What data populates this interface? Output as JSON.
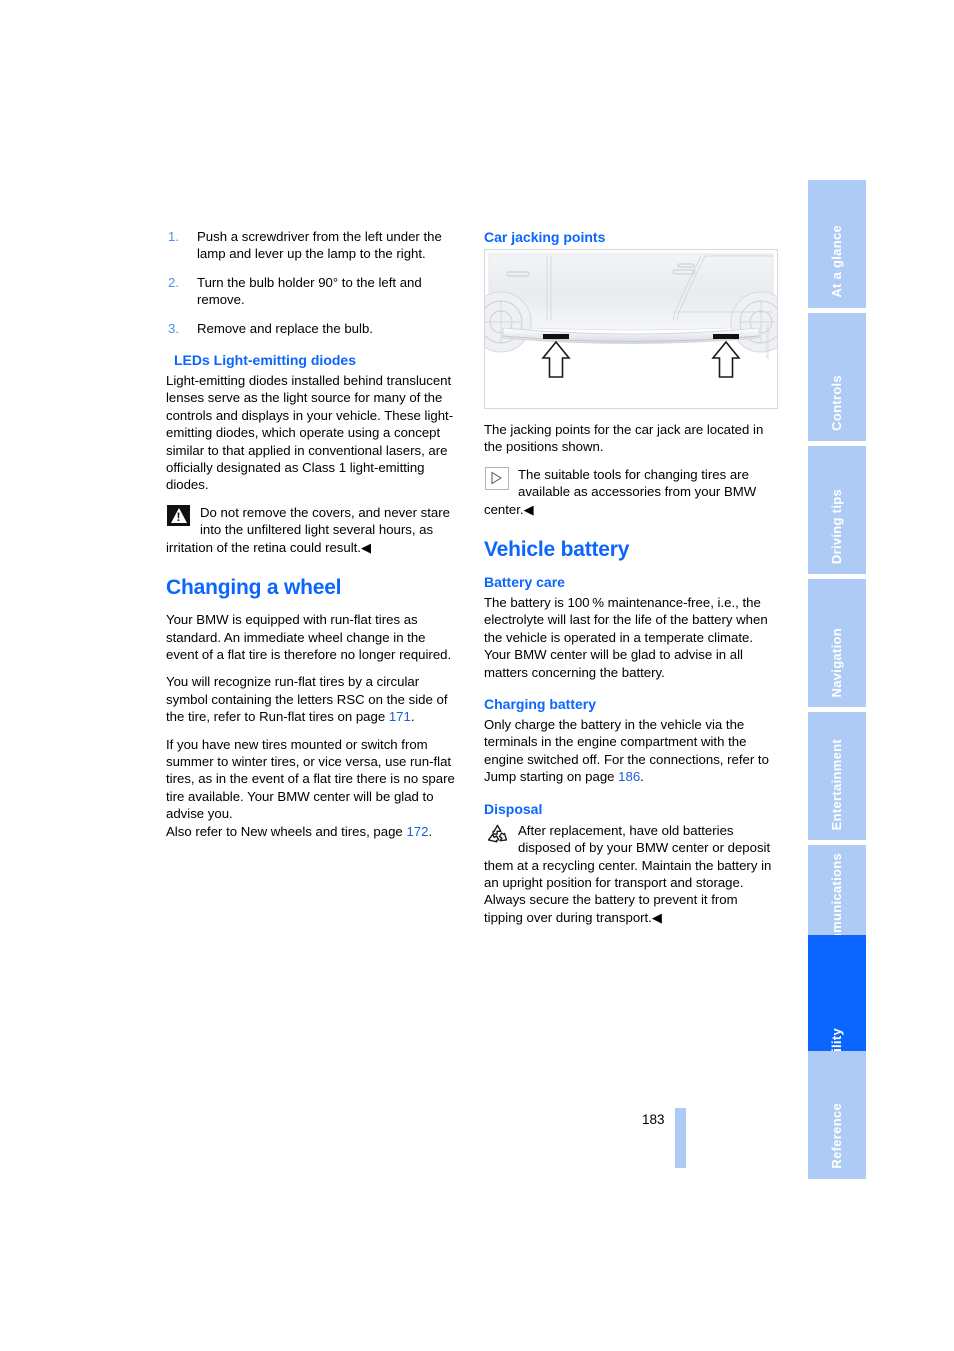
{
  "page": {
    "number": "183",
    "accent_blue": "#0a66ff",
    "tab_blue": "#aecbf5"
  },
  "tabs": [
    {
      "label": "At a glance",
      "active": false
    },
    {
      "label": "Controls",
      "active": false
    },
    {
      "label": "Driving tips",
      "active": false
    },
    {
      "label": "Navigation",
      "active": false
    },
    {
      "label": "Entertainment",
      "active": false
    },
    {
      "label": "Communications",
      "active": false
    },
    {
      "label": "Mobility",
      "active": true
    },
    {
      "label": "Reference",
      "active": false
    }
  ],
  "left_column": {
    "steps": [
      {
        "num": "1.",
        "text": "Push a screwdriver from the left under the lamp and lever up the lamp to the right."
      },
      {
        "num": "2.",
        "text": "Turn the bulb holder 90° to the left and remove."
      },
      {
        "num": "3.",
        "text": "Remove and replace the bulb."
      }
    ],
    "leds_heading": "LEDs Light-emitting diodes",
    "leds_body": "Light-emitting diodes installed behind translucent lenses serve as the light source for many of the controls and displays in your vehicle. These light-emitting diodes, which operate using a concept similar to that applied in conventional lasers, are officially designated as Class 1 light-emitting diodes.",
    "warning_icon": "warning-triangle-icon",
    "warning_text": "Do not remove the covers, and never stare into the unfiltered light several hours, as irritation of the retina could result.◀",
    "changing_wheel_heading": "Changing a wheel",
    "changing_wheel_p1": "Your BMW is equipped with run-flat tires as standard. An immediate wheel change in the event of a flat tire is therefore no longer required.",
    "changing_wheel_p2_a": "You will recognize run-flat tires by a circular symbol containing the letters RSC on the side of the tire, refer to Run-flat tires on page ",
    "changing_wheel_p2_ref": "171",
    "changing_wheel_p2_b": ".",
    "changing_wheel_p3": " If you have new tires mounted or switch from summer to winter tires, or vice versa, use run-flat tires, as in the event of a flat tire there is no spare tire available. Your BMW center will be glad to advise you.",
    "changing_wheel_p4_a": "Also refer to New wheels and tires, page ",
    "changing_wheel_p4_ref": "172",
    "changing_wheel_p4_b": "."
  },
  "right_column": {
    "jacking_heading": "Car jacking points",
    "figure": {
      "name": "car-jacking-points-illustration",
      "figure_id": "VW/H/2233AW"
    },
    "jacking_body": "The jacking points for the car jack are located in the positions shown.",
    "note_icon": "note-triangle-icon",
    "note_text": "The suitable tools for changing tires are available as accessories from your BMW center.◀",
    "battery_heading": "Vehicle battery",
    "battery_care_heading": "Battery care",
    "battery_care_p1": "The battery is 100 % maintenance-free, i.e., the electrolyte will last for the life of the battery when the vehicle is operated in a temperate climate.",
    "battery_care_p2": "Your BMW center will be glad to advise in all matters concerning the battery.",
    "charging_heading": "Charging battery",
    "charging_text_a": "Only charge the battery in the vehicle via the terminals in the engine compartment with the engine switched off. For the connections, refer to Jump starting on page ",
    "charging_ref": "186",
    "charging_text_b": ".",
    "disposal_heading": "Disposal",
    "disposal_icon": "recycle-icon",
    "disposal_text": "After replacement, have old batteries disposed of by your BMW center or deposit them at a recycling center. Maintain the battery in an upright position for transport and storage. Always secure the battery to prevent it from tipping over during transport.◀"
  }
}
